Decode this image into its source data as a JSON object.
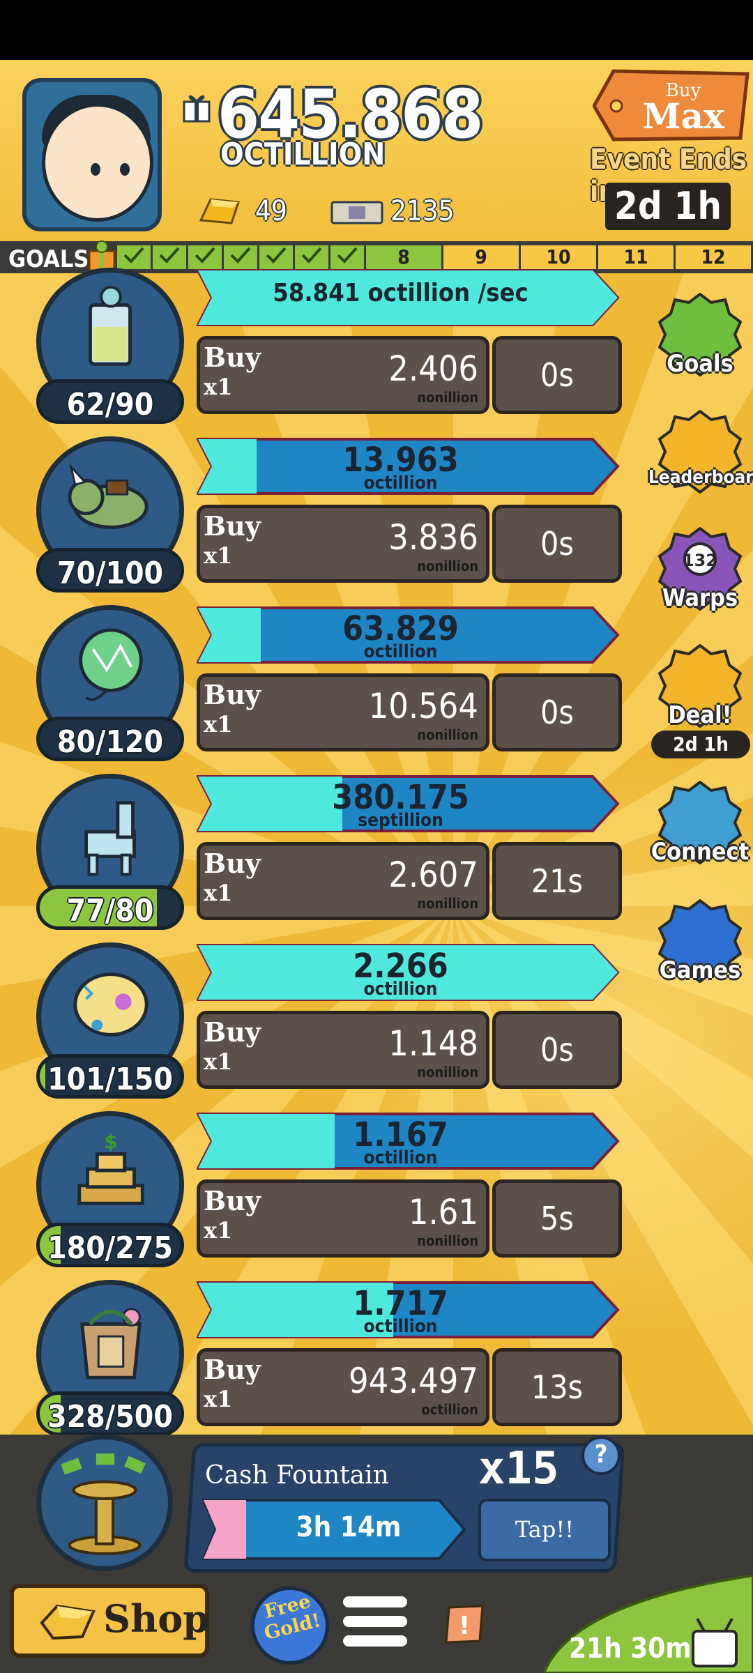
{
  "header": {
    "cash_value": "645.868",
    "cash_unit": "OCTILLION",
    "gold": "49",
    "megabucks": "2135",
    "buy_max_top": "Buy",
    "buy_max_bottom": "Max",
    "event_label": "Event Ends in:",
    "event_time": "2d 1h"
  },
  "goals": {
    "label": "GOALS",
    "completed": 7,
    "levels": [
      "8",
      "9",
      "10",
      "11",
      "12"
    ]
  },
  "businesses": [
    {
      "icon": "lemonade-icon",
      "owned": "62/90",
      "owned_progress": 0.0,
      "progress_text": "58.841 octillion /sec",
      "progress_fill": 1.0,
      "buy_label": "Buy",
      "buy_mult": "x1",
      "cost": "2.406",
      "cost_unit": "nonillion",
      "timer": "0s",
      "rate_mode": true
    },
    {
      "icon": "triceratops-icon",
      "owned": "70/100",
      "owned_progress": 0.0,
      "progress_value": "13.963",
      "progress_unit": "octillion",
      "progress_fill": 0.15,
      "buy_label": "Buy",
      "buy_mult": "x1",
      "cost": "3.836",
      "cost_unit": "nonillion",
      "timer": "0s"
    },
    {
      "icon": "balloon-icon",
      "owned": "80/120",
      "owned_progress": 0.0,
      "progress_value": "63.829",
      "progress_unit": "octillion",
      "progress_fill": 0.16,
      "buy_label": "Buy",
      "buy_mult": "x1",
      "cost": "10.564",
      "cost_unit": "nonillion",
      "timer": "0s"
    },
    {
      "icon": "llama-pinata-icon",
      "owned": "77/80",
      "owned_progress": 0.83,
      "progress_value": "380.175",
      "progress_unit": "septillion",
      "progress_fill": 0.37,
      "buy_label": "Buy",
      "buy_mult": "x1",
      "cost": "2.607",
      "cost_unit": "nonillion",
      "timer": "21s"
    },
    {
      "icon": "party-confetti-icon",
      "owned": "101/150",
      "owned_progress": 0.04,
      "progress_value": "2.266",
      "progress_unit": "octillion",
      "progress_fill": 1.0,
      "buy_label": "Buy",
      "buy_mult": "x1",
      "cost": "1.148",
      "cost_unit": "nonillion",
      "timer": "0s"
    },
    {
      "icon": "cake-icon",
      "owned": "180/275",
      "owned_progress": 0.15,
      "progress_value": "1.167",
      "progress_unit": "octillion",
      "progress_fill": 0.35,
      "buy_label": "Buy",
      "buy_mult": "x1",
      "cost": "1.61",
      "cost_unit": "nonillion",
      "timer": "5s"
    },
    {
      "icon": "gift-bag-icon",
      "owned": "328/500",
      "owned_progress": 0.15,
      "progress_value": "1.717",
      "progress_unit": "octillion",
      "progress_fill": 0.5,
      "buy_label": "Buy",
      "buy_mult": "x1",
      "cost": "943.497",
      "cost_unit": "octillion",
      "timer": "13s"
    }
  ],
  "side_buttons": [
    {
      "label": "Goals",
      "icon": "goals-checklist-icon",
      "color": "#6fbf3f"
    },
    {
      "label": "Leaderboard",
      "icon": "trophy-icon",
      "color": "#f2b52a"
    },
    {
      "label": "Warps",
      "icon": "warp-clock-icon",
      "color": "#8a55b8",
      "count": "132"
    },
    {
      "label": "Deal!",
      "icon": "deal-gift-icon",
      "color": "#f2b52a",
      "time": "2d 1h"
    },
    {
      "label": "Connect",
      "icon": "cards-icon",
      "color": "#3f9fd0"
    },
    {
      "label": "Games",
      "icon": "hippo-icon",
      "color": "#2d6fd0"
    }
  ],
  "fountain": {
    "title": "Cash Fountain",
    "multiplier": "x15",
    "help": "?",
    "timer": "3h 14m",
    "timer_fill": 0.18,
    "tap_label": "Tap!!"
  },
  "bottom": {
    "shop_label": "Shop",
    "free_gold_line1": "Free",
    "free_gold_line2": "Gold!",
    "alert": "!",
    "tv_time": "21h 30m"
  },
  "colors": {
    "progress_cyan": "#4fe8dc",
    "progress_blue": "#1f86c6",
    "progress_border": "#7a1f3a",
    "owned_green": "#8cc63f",
    "goals_green": "#8cc63f",
    "goals_yellow": "#f7c843"
  }
}
